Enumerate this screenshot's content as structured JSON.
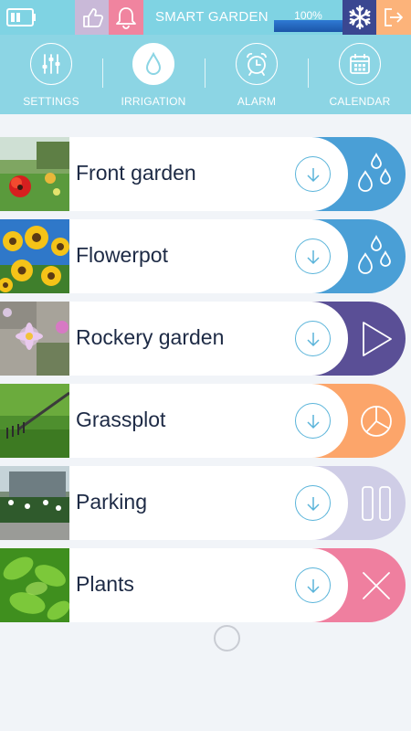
{
  "topbar": {
    "title": "SMART GARDEN",
    "progress_text": "100%",
    "progress_value": 1.0,
    "icons": [
      "battery-icon",
      "thumbs-up-icon",
      "bell-icon",
      "snowflake-icon",
      "exit-icon"
    ],
    "colors": {
      "bar": "#7fd3e3",
      "like": "#c9b9d8",
      "bell": "#f0849f",
      "snow": "#3a4791",
      "exit": "#fcb37a",
      "progress": "#1b55a8"
    }
  },
  "nav": {
    "items": [
      {
        "label": "SETTINGS",
        "icon": "sliders-icon",
        "active": false
      },
      {
        "label": "IRRIGATION",
        "icon": "water-drop-icon",
        "active": true
      },
      {
        "label": "ALARM",
        "icon": "alarm-clock-icon",
        "active": false
      },
      {
        "label": "CALENDAR",
        "icon": "calendar-icon",
        "active": false
      }
    ]
  },
  "gardens": [
    {
      "name": "Front garden",
      "action_icon": "water-drops-icon",
      "action_color": "#4a9fd6",
      "thumb": "red-flower-photo"
    },
    {
      "name": "Flowerpot",
      "action_icon": "water-drops-icon",
      "action_color": "#4a9fd6",
      "thumb": "sunflowers-photo"
    },
    {
      "name": "Rockery garden",
      "action_icon": "play-icon",
      "action_color": "#5a4f96",
      "thumb": "daisy-rocks-photo"
    },
    {
      "name": "Grassplot",
      "action_icon": "pie-chart-icon",
      "action_color": "#fca56a",
      "thumb": "grass-rake-photo"
    },
    {
      "name": "Parking",
      "action_icon": "pause-icon",
      "action_color": "#cfcde6",
      "thumb": "hedge-house-photo"
    },
    {
      "name": "Plants",
      "action_icon": "close-icon",
      "action_color": "#ef7f9f",
      "thumb": "green-leaves-photo"
    }
  ]
}
